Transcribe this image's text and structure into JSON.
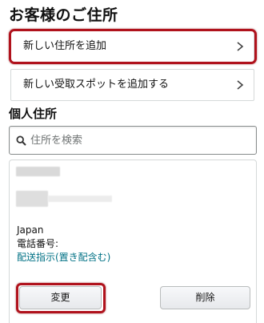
{
  "page": {
    "title": "お客様のご住所"
  },
  "actions": {
    "add_address_label": "新しい住所を追加",
    "add_pickup_label": "新しい受取スポットを追加する"
  },
  "personal": {
    "section_title": "個人住所",
    "search": {
      "placeholder": "住所を検索",
      "value": ""
    }
  },
  "address_card": {
    "country": "Japan",
    "phone_label": "電話番号:",
    "delivery_instructions_link": "配送指示(置き配含む)",
    "change_button": "変更",
    "delete_button": "削除"
  },
  "colors": {
    "highlight": "#b0121c",
    "link": "#007185",
    "border": "#d5d9d9"
  },
  "icons": {
    "chevron": "chevron-right-icon",
    "search": "search-icon"
  }
}
